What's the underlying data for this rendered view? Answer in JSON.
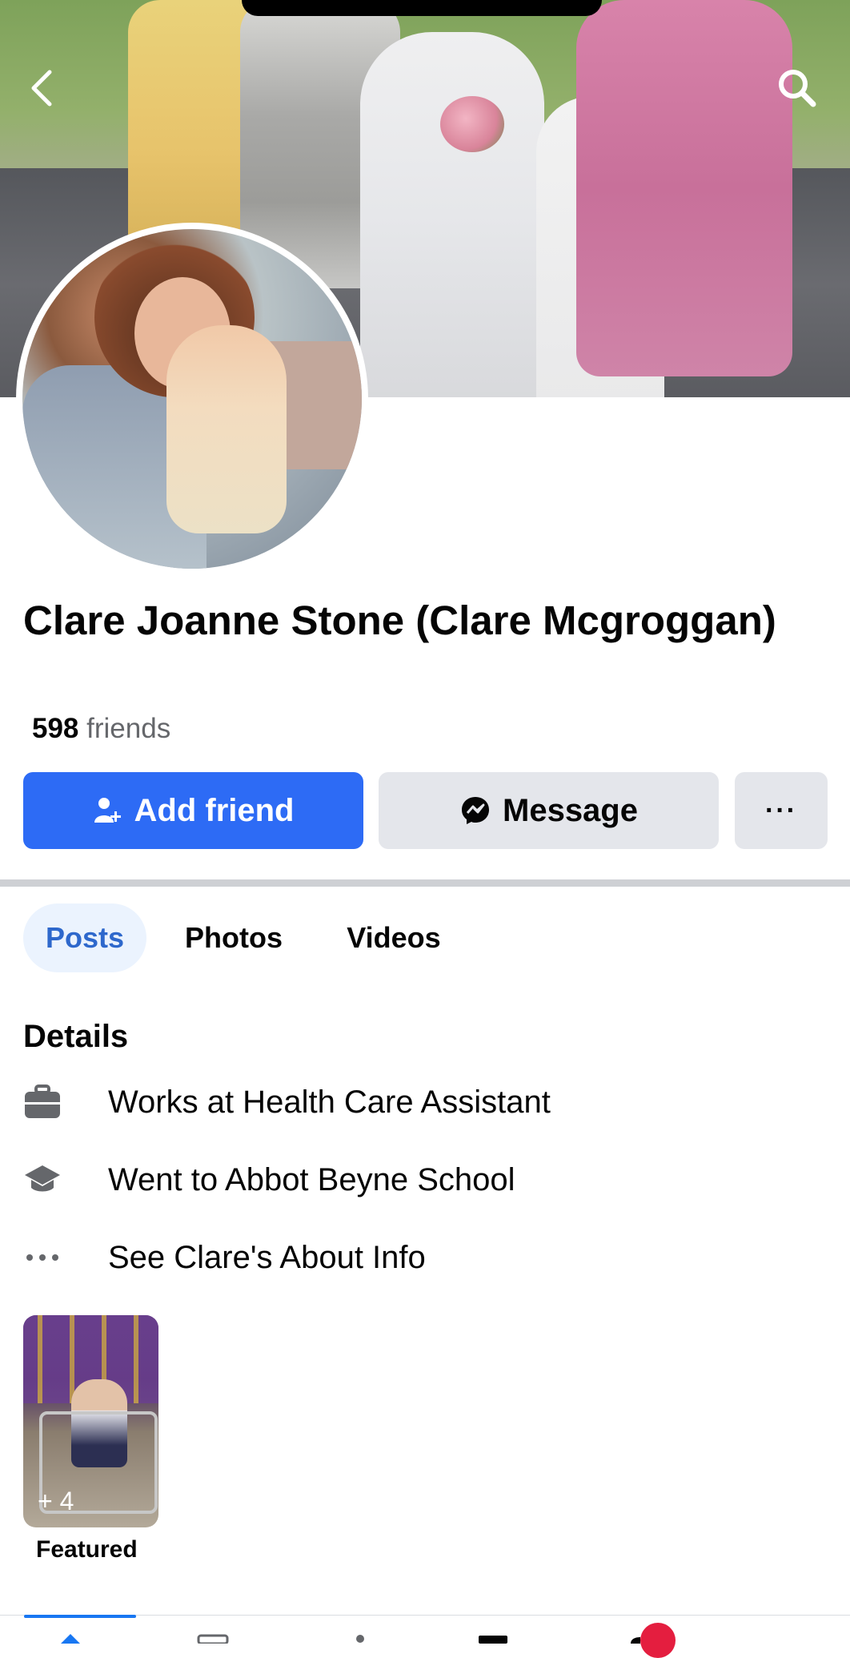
{
  "top_nav": {
    "back_icon": "back-chevron-icon",
    "search_icon": "search-icon"
  },
  "profile": {
    "name": "Clare Joanne Stone (Clare Mcgroggan)",
    "friends_count": "598",
    "friends_label": "friends"
  },
  "actions": {
    "add_friend_label": "Add friend",
    "message_label": "Message",
    "more_label": "···"
  },
  "tabs": [
    {
      "label": "Posts",
      "active": true
    },
    {
      "label": "Photos",
      "active": false
    },
    {
      "label": "Videos",
      "active": false
    }
  ],
  "details": {
    "title": "Details",
    "items": [
      {
        "icon": "briefcase-icon",
        "text": "Works at Health Care Assistant"
      },
      {
        "icon": "graduation-cap-icon",
        "text": "Went to Abbot Beyne School"
      },
      {
        "icon": "more-dots-icon",
        "text": "See Clare's About Info"
      }
    ]
  },
  "featured": {
    "count_label": "+ 4",
    "label": "Featured"
  },
  "colors": {
    "primary": "#2d6bf5",
    "tab_active_bg": "#ebf3fe",
    "tab_active_text": "#2e68cc",
    "secondary_button": "#e4e6eb",
    "notification_badge": "#e41e3f"
  }
}
